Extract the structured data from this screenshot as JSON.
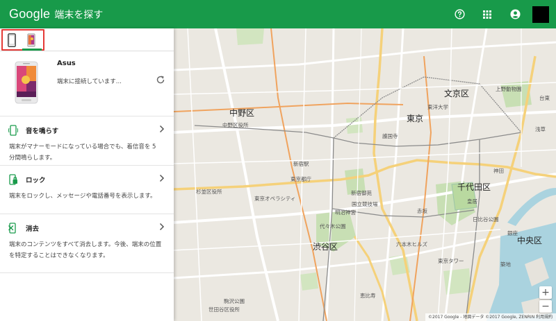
{
  "header": {
    "logo": "Google",
    "title": "端末を探す",
    "icons": [
      "help-icon",
      "apps-grid-icon",
      "account-icon"
    ],
    "colors": {
      "bar": "#189a4a",
      "text": "#ffffff"
    }
  },
  "device_tabs": {
    "tabs": [
      "phone-outline-icon",
      "asus-phone-icon"
    ],
    "selected_index": 1,
    "highlight_color": "#e53935"
  },
  "device": {
    "name": "Asus",
    "status": "端末に接続しています..."
  },
  "actions": [
    {
      "title": "音を鳴らす",
      "desc": "端末がマナーモードになっている場合でも、着信音を 5 分間鳴らします。",
      "icon": "ring-icon"
    },
    {
      "title": "ロック",
      "desc": "端末をロックし、メッセージや電話番号を表示します。",
      "icon": "lock-icon"
    },
    {
      "title": "消去",
      "desc": "端末のコンテンツをすべて消去します。今後、端末の位置を特定することはできなくなります。",
      "icon": "erase-icon"
    }
  ],
  "map": {
    "labels": {
      "nakano": "中野区",
      "tokyo": "東京",
      "bunkyo": "文京区",
      "chiyoda": "千代田区",
      "shibuya": "渋谷区",
      "chuo": "中央区",
      "ueno": "上野動物園",
      "taito": "台東",
      "shinjuku_gyoen": "新宿御苑",
      "yoyogi": "代々木公園",
      "meiji": "明治神宮",
      "kokuritsu": "国立競技場",
      "tocho": "東京都庁",
      "opera": "東京オペラシティ",
      "nakano_office": "中野区役所",
      "suginami": "杉並区役所",
      "komazawa": "駒沢公園",
      "kasumi": "新宿御苑",
      "kokyo": "皇居",
      "shinjuku": "新宿駅",
      "toyo": "東洋大学",
      "kishimo": "護国寺",
      "setagaya": "世田谷区役所",
      "ebisu": "恵比寿",
      "roppongi": "六本木ヒルズ",
      "tokyotower": "東京タワー",
      "tsukiji": "築地",
      "rou": "日比谷公園",
      "kanda": "神田",
      "akasaka": "赤坂",
      "asakusa": "浅草",
      "ginza": "銀座"
    },
    "attribution": "©2017 Google - 地図データ ©2017 Google, ZENRIN  利用規約",
    "zoom_in": "+",
    "zoom_out": "−"
  }
}
